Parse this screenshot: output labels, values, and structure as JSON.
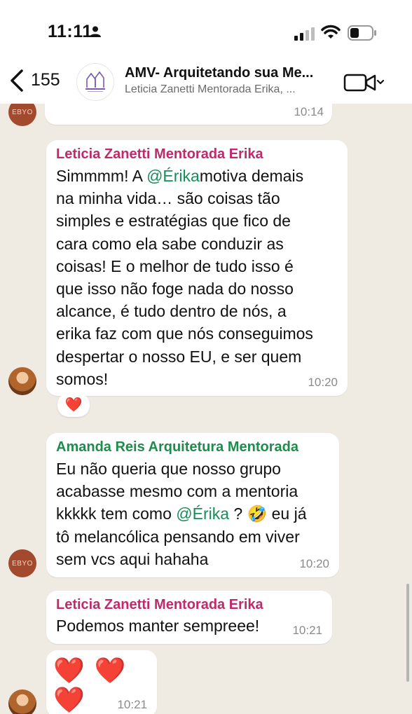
{
  "status_bar": {
    "time": "11:11"
  },
  "header": {
    "back_count": "155",
    "title": "AMV- Arquitetando sua Me...",
    "subtitle": "Leticia Zanetti Mentorada Erika, ..."
  },
  "messages": [
    {
      "time": "10:14"
    },
    {
      "sender": "Leticia Zanetti Mentorada Erika",
      "sender_color": "#c0296b",
      "text_lines": [
        "Simmmm! A ",
        "na minha vida… são coisas tão",
        "simples e estratégias que fico de",
        "cara como ela sabe conduzir as",
        "coisas! E o melhor de tudo isso é",
        "que isso não foge nada do nosso",
        "alcance, é tudo dentro de nós, a",
        "erika faz com que nós conseguimos",
        "despertar o nosso EU, e ser quem",
        "somos!"
      ],
      "mention": "@Érika",
      "after_mention": "motiva demais",
      "time": "10:20",
      "reaction": "❤️"
    },
    {
      "sender": "Amanda Reis Arquitetura Mentorada",
      "sender_color": "#1f8b4c",
      "line1": "Eu não queria que nosso grupo",
      "line2": "acabasse mesmo com a mentoria",
      "line3_before": "kkkkk tem como ",
      "mention": "@Érika",
      "line3_after": " ? 🤣 eu já",
      "line4": "tô melancólica pensando em viver",
      "line5": "sem vcs aqui hahaha",
      "time": "10:20"
    },
    {
      "sender": "Leticia Zanetti Mentorada Erika",
      "sender_color": "#c0296b",
      "text": "Podemos manter sempreee!",
      "time": "10:21"
    },
    {
      "hearts": "❤️ ❤️ ❤️",
      "time": "10:21"
    }
  ],
  "avatars": {
    "ebyo_label": "EBYO"
  },
  "colors": {
    "background": "#efeae2",
    "bubble": "#ffffff",
    "mention": "#1a8b5a"
  }
}
